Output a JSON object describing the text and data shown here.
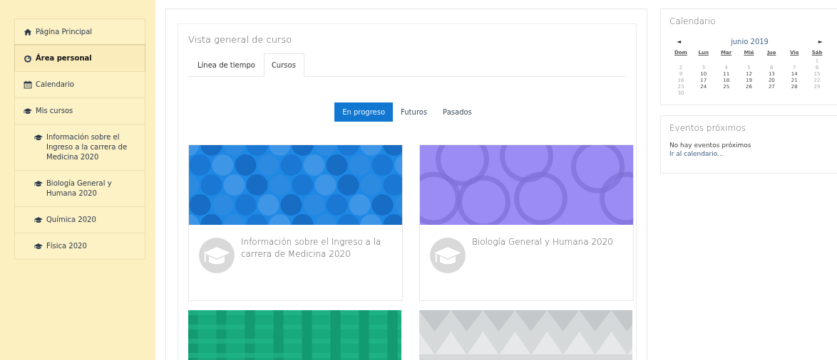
{
  "sidebar": {
    "items": [
      {
        "label": "Página Principal",
        "kind": "home",
        "selected": false
      },
      {
        "label": "Área personal",
        "kind": "dashboard",
        "selected": true
      },
      {
        "label": "Calendario",
        "kind": "calendar",
        "selected": false
      },
      {
        "label": "Mis cursos",
        "kind": "courses",
        "selected": false,
        "children": [
          {
            "label": "Información sobre el Ingreso a la carrera de Medicina 2020",
            "kind": "courses",
            "selected": false
          },
          {
            "label": "Biología General y Humana 2020",
            "kind": "courses",
            "selected": false
          },
          {
            "label": "Química 2020",
            "kind": "courses",
            "selected": false
          },
          {
            "label": "Física 2020",
            "kind": "courses",
            "selected": false
          }
        ]
      }
    ]
  },
  "course_overview": {
    "title": "Vista general de curso",
    "tabs": [
      {
        "label": "Línea de tiempo",
        "selected": false
      },
      {
        "label": "Cursos",
        "selected": true
      }
    ],
    "filters": [
      {
        "label": "En progreso",
        "selected": true
      },
      {
        "label": "Futuros",
        "selected": false
      },
      {
        "label": "Pasados",
        "selected": false
      }
    ],
    "courses": [
      {
        "name": "Información sobre el Ingreso a la carrera de Medicina 2020"
      },
      {
        "name": "Biología General y Humana 2020"
      },
      {
        "kind": "picture"
      },
      {
        "kind": "picture"
      }
    ]
  },
  "calendar": {
    "title": "Calendario",
    "prev": "◄",
    "month": "junio 2019",
    "next": "►",
    "weekdays": [
      "Dom",
      "Lun",
      "Mar",
      "Mié",
      "Jue",
      "Vie",
      "Sáb"
    ],
    "weeks": [
      [
        {
          "day": "1",
          "muted": true
        }
      ],
      [
        {
          "day": "2",
          "muted": true
        },
        {
          "day": "3",
          "muted": true
        },
        {
          "day": "4",
          "muted": true
        },
        {
          "day": "5",
          "muted": true
        },
        {
          "day": "6",
          "muted": true
        },
        {
          "day": "7",
          "muted": true
        },
        {
          "day": "8",
          "muted": true
        }
      ],
      [
        {
          "day": "9",
          "muted": true
        },
        {
          "day": "10",
          "muted": false
        },
        {
          "day": "11",
          "muted": false
        },
        {
          "day": "12",
          "muted": false
        },
        {
          "day": "13",
          "muted": false
        },
        {
          "day": "14",
          "muted": false
        },
        {
          "day": "15",
          "muted": true
        }
      ],
      [
        {
          "day": "16",
          "muted": true
        },
        {
          "day": "17",
          "muted": false
        },
        {
          "day": "18",
          "muted": false
        },
        {
          "day": "19",
          "muted": false
        },
        {
          "day": "20",
          "muted": false
        },
        {
          "day": "21",
          "muted": false
        },
        {
          "day": "22",
          "muted": true
        }
      ],
      [
        {
          "day": "23",
          "muted": true
        },
        {
          "day": "24",
          "muted": false
        },
        {
          "day": "25",
          "muted": false
        },
        {
          "day": "26",
          "muted": false
        },
        {
          "day": "27",
          "muted": false
        },
        {
          "day": "28",
          "muted": false
        },
        {
          "day": "29",
          "muted": true
        }
      ],
      [
        {
          "day": "30",
          "muted": true
        }
      ]
    ]
  },
  "upcoming_events": {
    "title": "Eventos próximos",
    "message": "No hay eventos próximos",
    "link": "Ir al calendario..."
  }
}
